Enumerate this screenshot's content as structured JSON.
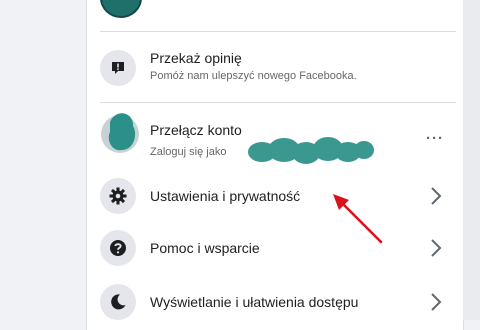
{
  "menu": {
    "feedback": {
      "label": "Przekaż opinię",
      "sub": "Pomóż nam ulepszyć nowego Facebooka.",
      "icon": "feedback-icon"
    },
    "switch_account": {
      "label": "Przełącz konto",
      "sub": "Zaloguj się jako",
      "more": "···",
      "icon": "account-avatar"
    },
    "settings": {
      "label": "Ustawienia i prywatność",
      "icon": "gear-icon"
    },
    "help": {
      "label": "Pomoc i wsparcie",
      "icon": "question-icon"
    },
    "display": {
      "label": "Wyświetlanie i ułatwienia dostępu",
      "icon": "moon-icon"
    }
  },
  "colors": {
    "annotation": "#d8121a",
    "icon_bg": "#e4e6eb",
    "redaction": "#2a9088"
  }
}
